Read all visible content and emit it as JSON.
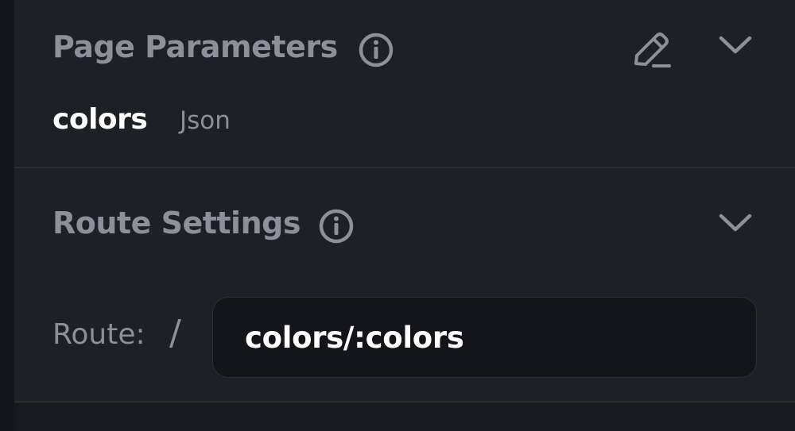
{
  "page_parameters": {
    "title": "Page Parameters",
    "icons": {
      "info": "info-icon",
      "edit": "edit-pencil-icon",
      "collapse": "chevron-down-icon"
    },
    "parameters": [
      {
        "name": "colors",
        "type": "Json"
      }
    ]
  },
  "route_settings": {
    "title": "Route Settings",
    "icons": {
      "info": "info-icon",
      "collapse": "chevron-down-icon"
    },
    "route_label": "Route:",
    "route_prefix": "/",
    "route_value": "colors/:colors"
  },
  "colors": {
    "background": "#1d2024",
    "muted_text": "#8a9198",
    "primary_text": "#ffffff",
    "input_background": "#131518"
  }
}
